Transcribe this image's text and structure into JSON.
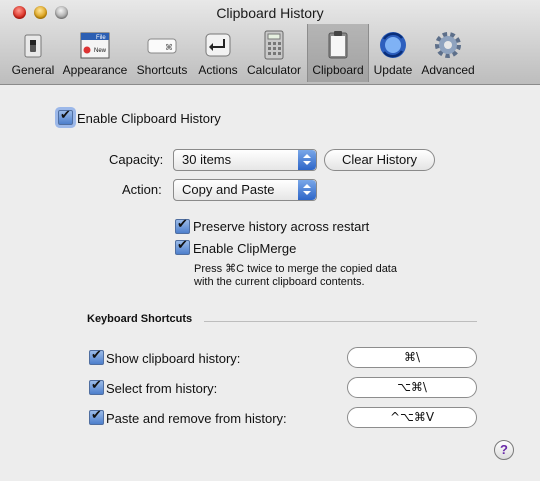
{
  "window": {
    "title": "Clipboard History"
  },
  "toolbar": {
    "items": [
      {
        "label": "General",
        "icon": "switch-icon"
      },
      {
        "label": "Appearance",
        "icon": "window-menu-icon"
      },
      {
        "label": "Shortcuts",
        "icon": "keyboard-key-icon"
      },
      {
        "label": "Actions",
        "icon": "return-arrow-icon"
      },
      {
        "label": "Calculator",
        "icon": "calculator-icon"
      },
      {
        "label": "Clipboard",
        "icon": "clipboard-icon"
      },
      {
        "label": "Update",
        "icon": "globe-sync-icon"
      },
      {
        "label": "Advanced",
        "icon": "gear-icon"
      }
    ],
    "selected": "Clipboard",
    "appearance_icon_text": {
      "file": "File",
      "new": "New"
    },
    "shortcuts_icon_text": "⌘"
  },
  "main": {
    "enable_label": "Enable Clipboard History",
    "capacity_label": "Capacity:",
    "capacity_value": "30 items",
    "clear_button": "Clear History",
    "action_label": "Action:",
    "action_value": "Copy and Paste",
    "preserve_label": "Preserve history across restart",
    "clipmerge_label": "Enable ClipMerge",
    "clipmerge_help_1": "Press ⌘C twice to merge the copied data",
    "clipmerge_help_2": "with the current clipboard contents.",
    "section_title": "Keyboard Shortcuts",
    "shortcuts": [
      {
        "label": "Show clipboard history:",
        "keys": "⌘\\",
        "checked": true
      },
      {
        "label": "Select from history:",
        "keys": "⌥⌘\\",
        "checked": true
      },
      {
        "label": "Paste and remove from history:",
        "keys": "^⌥⌘V",
        "checked": true
      }
    ],
    "help_button": "?"
  },
  "colors": {
    "accent": "#4d7fcc",
    "help": "#6a2aa8"
  }
}
